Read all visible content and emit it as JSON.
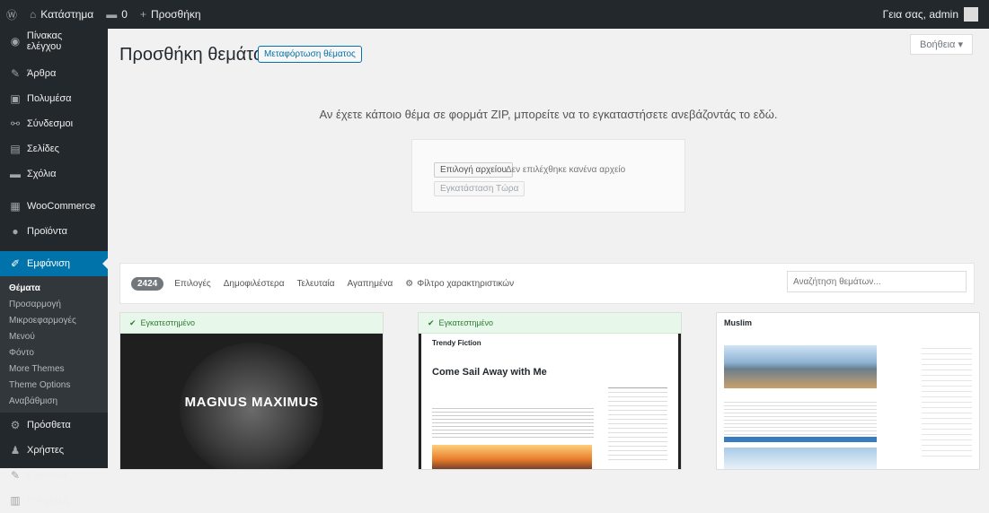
{
  "admin_bar": {
    "site_name": "Κατάστημα",
    "comments_count": "0",
    "new_label": "Προσθήκη",
    "greeting": "Γεια σας, admin"
  },
  "sidebar": {
    "items": [
      {
        "label": "Πίνακας ελέγχου",
        "icon": "dashboard-icon",
        "glyph": "◉"
      },
      {
        "label": "Άρθρα",
        "icon": "pin-icon",
        "glyph": "✎"
      },
      {
        "label": "Πολυμέσα",
        "icon": "media-icon",
        "glyph": "▣"
      },
      {
        "label": "Σύνδεσμοι",
        "icon": "link-icon",
        "glyph": "⚯"
      },
      {
        "label": "Σελίδες",
        "icon": "pages-icon",
        "glyph": "▤"
      },
      {
        "label": "Σχόλια",
        "icon": "comments-icon",
        "glyph": "▬"
      },
      {
        "label": "WooCommerce",
        "icon": "woocommerce-icon",
        "glyph": "▦"
      },
      {
        "label": "Προϊόντα",
        "icon": "products-icon",
        "glyph": "●"
      },
      {
        "label": "Εμφάνιση",
        "icon": "appearance-icon",
        "glyph": "✐"
      },
      {
        "label": "Πρόσθετα",
        "icon": "plugins-icon",
        "glyph": "⚙"
      },
      {
        "label": "Χρήστες",
        "icon": "users-icon",
        "glyph": "♟"
      },
      {
        "label": "Εργαλεία",
        "icon": "tools-icon",
        "glyph": "✎"
      },
      {
        "label": "Ρυθμίσεις",
        "icon": "settings-icon",
        "glyph": "▥"
      }
    ],
    "submenu": [
      "Θέματα",
      "Προσαρμογή",
      "Μικροεφαρμογές",
      "Μενού",
      "Φόντο",
      "More Themes",
      "Theme Options",
      "Αναβάθμιση"
    ]
  },
  "help_label": "Βοήθεια ▾",
  "page_title": "Προσθήκη θεμάτων",
  "upload_button": "Μεταφόρτωση θέματος",
  "upload_description": "Αν έχετε κάποιο θέμα σε φορμάτ ZIP, μπορείτε να το εγκαταστήσετε ανεβάζοντάς το εδώ.",
  "choose_file": "Επιλογή αρχείου",
  "no_file": "Δεν επιλέχθηκε κανένα αρχείο",
  "install_now": "Εγκατάσταση Τώρα",
  "filters": {
    "count": "2424",
    "links": [
      "Επιλογές",
      "Δημοφιλέστερα",
      "Τελευταία",
      "Αγαπημένα"
    ],
    "feature_filter": "Φίλτρο χαρακτηριστικών",
    "search_placeholder": "Αναζήτηση θεμάτων..."
  },
  "themes": [
    {
      "installed": "Εγκατεστημένο",
      "title": "MAGNUS MAXIMUS"
    },
    {
      "installed": "Εγκατεστημένο",
      "site": "Trendy Fiction",
      "post_title": "Come Sail Away with Me"
    },
    {
      "brand": "Muslim"
    }
  ],
  "colors": {
    "admin_dark": "#23282d",
    "active_blue": "#0073aa",
    "installed_green": "#e7f7ea"
  }
}
